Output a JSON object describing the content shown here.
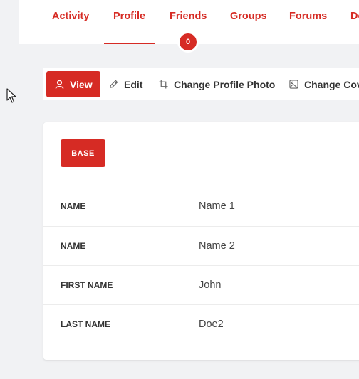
{
  "nav": {
    "items": [
      {
        "label": "Activity"
      },
      {
        "label": "Profile"
      },
      {
        "label": "Friends"
      },
      {
        "label": "Groups"
      },
      {
        "label": "Forums"
      },
      {
        "label": "Do"
      }
    ],
    "active": "Profile",
    "friends_badge": "0"
  },
  "profile_tabs": {
    "view": "View",
    "edit": "Edit",
    "change_photo": "Change Profile Photo",
    "change_cover": "Change Cov"
  },
  "profile": {
    "group_label": "BASE",
    "fields": [
      {
        "label": "NAME",
        "value": "Name 1"
      },
      {
        "label": "NAME",
        "value": "Name 2"
      },
      {
        "label": "FIRST NAME",
        "value": "John"
      },
      {
        "label": "LAST NAME",
        "value": "Doe2"
      }
    ]
  },
  "colors": {
    "accent": "#d62b24",
    "page_background": "#f1f2f4",
    "card_background": "#ffffff",
    "text": "#333333"
  },
  "icons": {
    "view": "user-icon",
    "edit": "pencil-icon",
    "change_photo": "crop-icon",
    "change_cover": "image-icon",
    "cursor": "mouse-pointer-icon"
  }
}
